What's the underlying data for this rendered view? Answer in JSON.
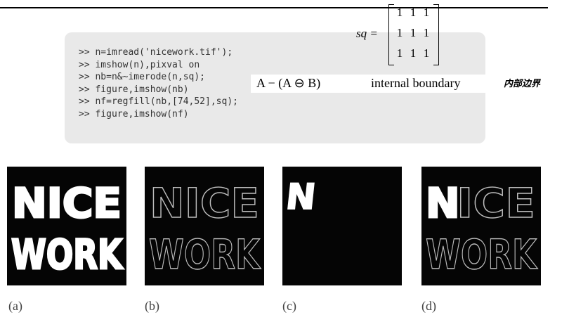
{
  "code": {
    "lines": [
      ">> n=imread('nicework.tif');",
      ">> imshow(n),pixval on",
      ">> nb=n&~imerode(n,sq);",
      ">> figure,imshow(nb)",
      ">> nf=regfill(nb,[74,52],sq);",
      ">> figure,imshow(nf)"
    ]
  },
  "matrix": {
    "lhs": "sq =",
    "rows": [
      [
        "1",
        "1",
        "1"
      ],
      [
        "1",
        "1",
        "1"
      ],
      [
        "1",
        "1",
        "1"
      ]
    ]
  },
  "annotation": {
    "formula": "A − (A ⊖ B)",
    "description": "internal boundary",
    "chinese_note": "内部边界"
  },
  "figure": {
    "panels": [
      {
        "caption": "(a)",
        "line1": "NICE",
        "line2": "WORK"
      },
      {
        "caption": "(b)",
        "line1": "NICE",
        "line2": "WORK"
      },
      {
        "caption": "(c)",
        "line1": "N"
      },
      {
        "caption": "(d)",
        "line1_filled": "N",
        "line1_rest": "ICE",
        "line2": "WORK"
      }
    ]
  },
  "colors": {
    "code_background": "#e9e9e9",
    "panel_background": "#050505",
    "text_white": "#ffffff",
    "outline_gray": "#bdbdbd"
  }
}
